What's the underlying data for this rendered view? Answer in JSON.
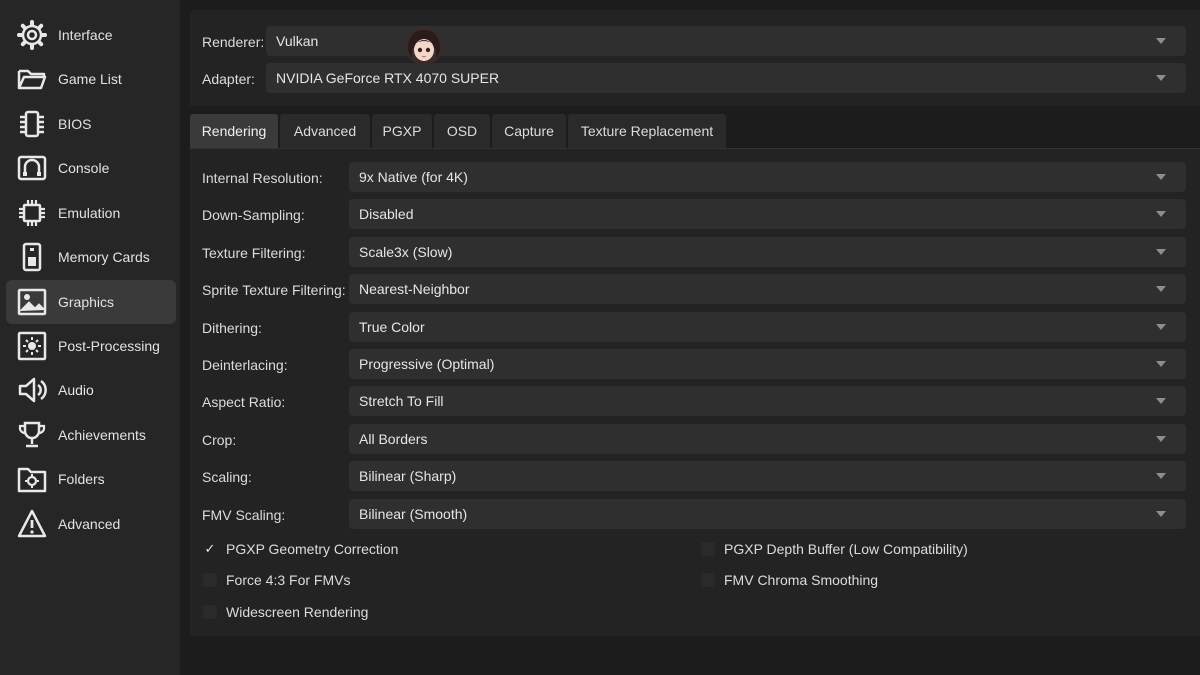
{
  "sidebar": {
    "items": [
      {
        "label": "Interface",
        "icon": "gear-icon"
      },
      {
        "label": "Game List",
        "icon": "folder-open-icon"
      },
      {
        "label": "BIOS",
        "icon": "chip-icon"
      },
      {
        "label": "Console",
        "icon": "console-icon"
      },
      {
        "label": "Emulation",
        "icon": "cpu-icon"
      },
      {
        "label": "Memory Cards",
        "icon": "memory-card-icon"
      },
      {
        "label": "Graphics",
        "icon": "image-icon",
        "active": true
      },
      {
        "label": "Post-Processing",
        "icon": "sun-icon"
      },
      {
        "label": "Audio",
        "icon": "speaker-icon"
      },
      {
        "label": "Achievements",
        "icon": "trophy-icon"
      },
      {
        "label": "Folders",
        "icon": "folder-gear-icon"
      },
      {
        "label": "Advanced",
        "icon": "warning-icon"
      }
    ]
  },
  "top": {
    "renderer_label": "Renderer:",
    "renderer_value": "Vulkan",
    "adapter_label": "Adapter:",
    "adapter_value": "NVIDIA GeForce RTX 4070 SUPER"
  },
  "tabs": [
    "Rendering",
    "Advanced",
    "PGXP",
    "OSD",
    "Capture",
    "Texture Replacement"
  ],
  "active_tab": "Rendering",
  "settings": [
    {
      "label": "Internal Resolution:",
      "value": "9x Native (for 4K)"
    },
    {
      "label": "Down-Sampling:",
      "value": "Disabled"
    },
    {
      "label": "Texture Filtering:",
      "value": "Scale3x (Slow)"
    },
    {
      "label": "Sprite Texture Filtering:",
      "value": "Nearest-Neighbor"
    },
    {
      "label": "Dithering:",
      "value": "True Color"
    },
    {
      "label": "Deinterlacing:",
      "value": "Progressive (Optimal)"
    },
    {
      "label": "Aspect Ratio:",
      "value": "Stretch To Fill"
    },
    {
      "label": "Crop:",
      "value": "All Borders"
    },
    {
      "label": "Scaling:",
      "value": "Bilinear (Sharp)"
    },
    {
      "label": "FMV Scaling:",
      "value": "Bilinear (Smooth)"
    }
  ],
  "checkboxes": [
    {
      "label": "PGXP Geometry Correction",
      "checked": true
    },
    {
      "label": "PGXP Depth Buffer (Low Compatibility)",
      "checked": false
    },
    {
      "label": "Force 4:3 For FMVs",
      "checked": false
    },
    {
      "label": "FMV Chroma Smoothing",
      "checked": false
    },
    {
      "label": "Widescreen Rendering",
      "checked": false
    }
  ],
  "colors": {
    "background": "#1c1c1c",
    "sidebar": "#262626",
    "panel": "#232323",
    "combo": "#2f2f2f",
    "active": "#3a3a3a"
  }
}
